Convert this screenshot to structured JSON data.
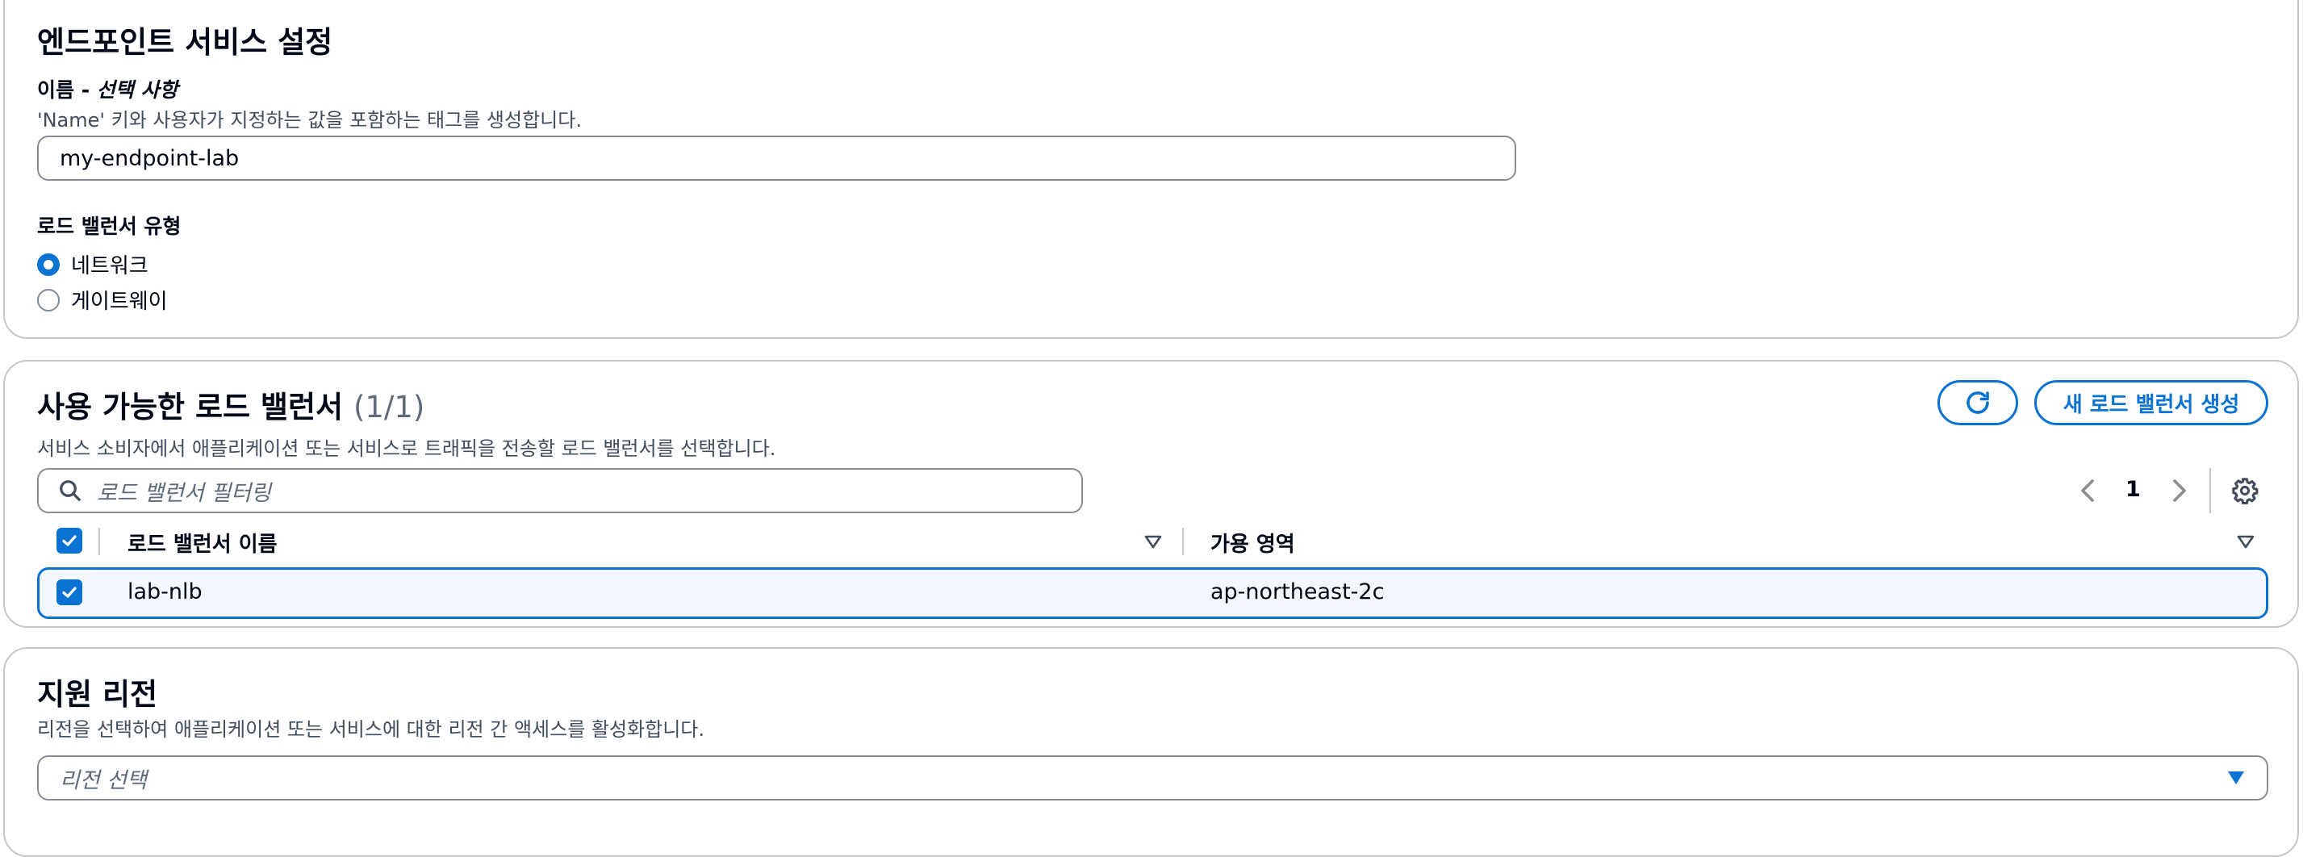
{
  "endpoint_settings": {
    "title": "엔드포인트 서비스 설정",
    "name_label_prefix": "이름 - ",
    "name_label_optional": "선택 사항",
    "name_description": "'Name' 키와 사용자가 지정하는 값을 포함하는 태그를 생성합니다.",
    "name_value": "my-endpoint-lab",
    "lb_type_label": "로드 밸런서 유형",
    "lb_type_options": [
      "네트워크",
      "게이트웨이"
    ],
    "lb_type_selected": "네트워크"
  },
  "available_lbs": {
    "title": "사용 가능한 로드 밸런서",
    "count": "(1/1)",
    "description": "서비스 소비자에서 애플리케이션 또는 서비스로 트래픽을 전송할 로드 밸런서를 선택합니다.",
    "create_button_label": "새 로드 밸런서 생성",
    "filter_placeholder": "로드 밸런서 필터링",
    "page_number": "1",
    "columns": [
      "로드 밸런서 이름",
      "가용 영역"
    ],
    "rows": [
      {
        "name": "lab-nlb",
        "az": "ap-northeast-2c",
        "selected": true
      }
    ]
  },
  "supported_regions": {
    "title": "지원 리전",
    "description": "리전을 선택하여 애플리케이션 또는 서비스에 대한 리전 간 액세스를 활성화합니다.",
    "select_placeholder": "리전 선택"
  },
  "colors": {
    "accent": "#0972d3",
    "border": "#c6c6cd",
    "text_secondary": "#5f6b7a",
    "selected_row_bg": "#f2f8fd"
  }
}
